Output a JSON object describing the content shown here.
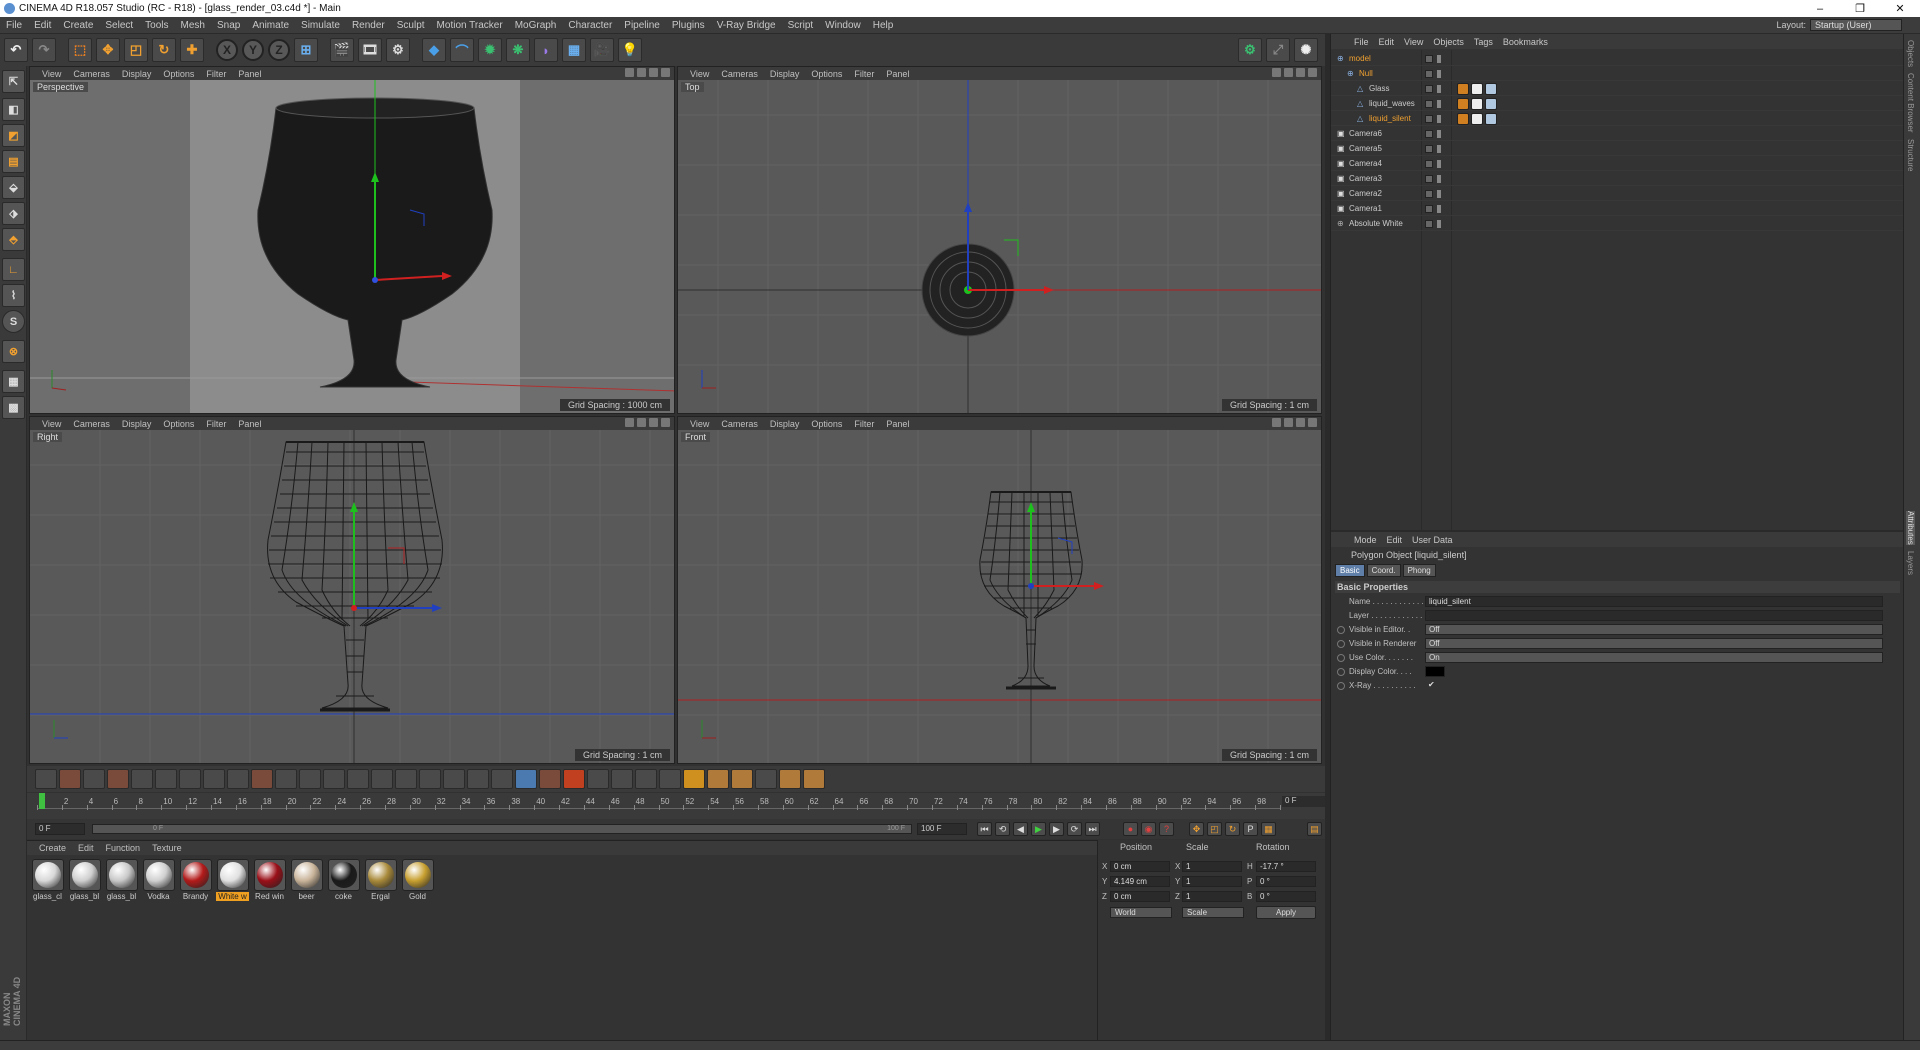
{
  "window": {
    "title": "CINEMA 4D R18.057 Studio (RC - R18) - [glass_render_03.c4d *] - Main",
    "minimize": "–",
    "restore": "❐",
    "close": "✕"
  },
  "menubar": {
    "items": [
      "File",
      "Edit",
      "Create",
      "Select",
      "Tools",
      "Mesh",
      "Snap",
      "Animate",
      "Simulate",
      "Render",
      "Sculpt",
      "Motion Tracker",
      "MoGraph",
      "Character",
      "Pipeline",
      "Plugins",
      "V-Ray Bridge",
      "Script",
      "Window",
      "Help"
    ],
    "layout_label": "Layout:",
    "layout_value": "Startup (User)"
  },
  "toolbar": {
    "axis_x": "X",
    "axis_y": "Y",
    "axis_z": "Z"
  },
  "viewports": {
    "menu": [
      "View",
      "Cameras",
      "Display",
      "Options",
      "Filter",
      "Panel"
    ],
    "perspective": {
      "name": "Perspective",
      "grid": "Grid Spacing : 1000 cm"
    },
    "top": {
      "name": "Top",
      "grid": "Grid Spacing : 1 cm"
    },
    "right": {
      "name": "Right",
      "grid": "Grid Spacing : 1 cm"
    },
    "front": {
      "name": "Front",
      "grid": "Grid Spacing : 1 cm"
    }
  },
  "timeline": {
    "ticks": [
      "0",
      "2",
      "4",
      "6",
      "8",
      "10",
      "12",
      "14",
      "16",
      "18",
      "20",
      "22",
      "24",
      "26",
      "28",
      "30",
      "32",
      "34",
      "36",
      "38",
      "40",
      "42",
      "44",
      "46",
      "48",
      "50",
      "52",
      "54",
      "56",
      "58",
      "60",
      "62",
      "64",
      "66",
      "68",
      "70",
      "72",
      "74",
      "76",
      "78",
      "80",
      "82",
      "84",
      "86",
      "88",
      "90",
      "92",
      "94",
      "96",
      "98",
      "100"
    ],
    "current_frame_display": "0 F",
    "start": "0 F",
    "slider_left": "0 F",
    "slider_right": "100 F",
    "end": "100 F",
    "play_icon": "▶"
  },
  "materials": {
    "menu": [
      "Create",
      "Edit",
      "Function",
      "Texture"
    ],
    "items": [
      {
        "label": "glass_cl",
        "color": "#d8d8d8"
      },
      {
        "label": "glass_bl",
        "color": "#cfcfcf"
      },
      {
        "label": "glass_bl",
        "color": "#c8c8c8"
      },
      {
        "label": "Vodka",
        "color": "#d0d0d0"
      },
      {
        "label": "Brandy",
        "color": "#b31a1a"
      },
      {
        "label": "White w",
        "color": "#e0e0e0",
        "selected": true
      },
      {
        "label": "Red win",
        "color": "#9a0f18"
      },
      {
        "label": "beer",
        "color": "#c9b49a"
      },
      {
        "label": "coke",
        "color": "#1a1a1a"
      },
      {
        "label": "Ergal",
        "color": "#a98a3a"
      },
      {
        "label": "Gold",
        "color": "#c8a030"
      }
    ]
  },
  "coordinates": {
    "headers": {
      "position": "Position",
      "scale": "Scale",
      "rotation": "Rotation"
    },
    "x": {
      "label": "X",
      "pos": "0 cm",
      "scale": "1",
      "rot_label": "H",
      "rot": "-17.7 °"
    },
    "y": {
      "label": "Y",
      "pos": "4.149 cm",
      "scale": "1",
      "rot_label": "P",
      "rot": "0 °"
    },
    "z": {
      "label": "Z",
      "pos": "0 cm",
      "scale": "1",
      "rot_label": "B",
      "rot": "0 °"
    },
    "space": "World",
    "mode": "Scale",
    "apply": "Apply"
  },
  "objects": {
    "menu": [
      "File",
      "Edit",
      "View",
      "Objects",
      "Tags",
      "Bookmarks"
    ],
    "rows": [
      {
        "name": "model",
        "indent": 0,
        "selected": true
      },
      {
        "name": "Null",
        "indent": 1,
        "selected": true
      },
      {
        "name": "Glass",
        "indent": 2,
        "selected": false,
        "tags": true
      },
      {
        "name": "liquid_waves",
        "indent": 2,
        "selected": false,
        "tags": true
      },
      {
        "name": "liquid_silent",
        "indent": 2,
        "selected": true,
        "tags": true
      },
      {
        "name": "Camera6",
        "indent": 0,
        "selected": false
      },
      {
        "name": "Camera5",
        "indent": 0,
        "selected": false
      },
      {
        "name": "Camera4",
        "indent": 0,
        "selected": false
      },
      {
        "name": "Camera3",
        "indent": 0,
        "selected": false
      },
      {
        "name": "Camera2",
        "indent": 0,
        "selected": false
      },
      {
        "name": "Camera1",
        "indent": 0,
        "selected": false
      },
      {
        "name": "Absolute White",
        "indent": 0,
        "selected": false
      }
    ]
  },
  "attributes": {
    "menu": [
      "Mode",
      "Edit",
      "User Data"
    ],
    "title": "Polygon Object [liquid_silent]",
    "tabs": [
      "Basic",
      "Coord.",
      "Phong"
    ],
    "section": "Basic Properties",
    "fields": {
      "name_label": "Name . . . . . . . . . . . .",
      "name_value": "liquid_silent",
      "layer_label": "Layer . . . . . . . . . . . .",
      "vis_editor_label": "Visible in Editor. .",
      "vis_editor_value": "Off",
      "vis_render_label": "Visible in Renderer",
      "vis_render_value": "Off",
      "use_color_label": "Use Color. . . . . . .",
      "use_color_value": "On",
      "display_color_label": "Display Color. . . .",
      "xray_label": "X-Ray . . . . . . . . . .",
      "xray_value": "✔"
    }
  },
  "side_tabs": [
    "Objects",
    "Content Browser",
    "Structure",
    "Attributes",
    "Layers"
  ],
  "colors": {
    "accent": "#f0a030",
    "selection_blue": "#5f7fa8"
  }
}
